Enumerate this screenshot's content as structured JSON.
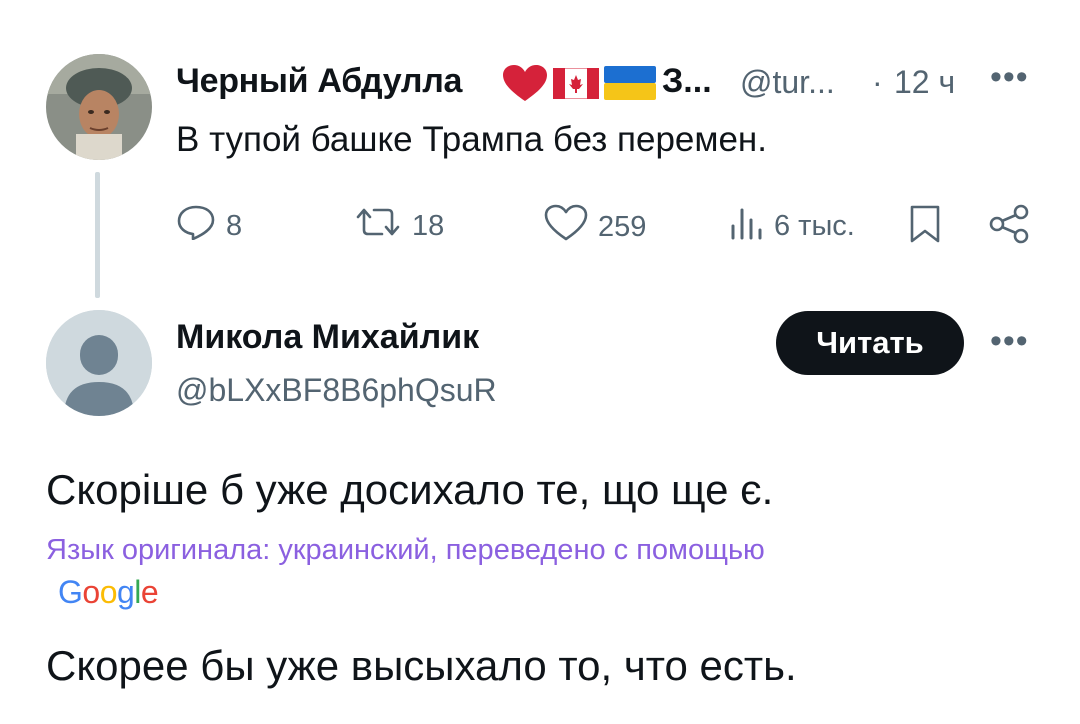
{
  "tweet": {
    "author_name": "Черный Абдулла",
    "author_name_tail": "З...",
    "handle": "@tur...",
    "separator": "·",
    "time": "12 ч",
    "more": "•••",
    "text": "В тупой башке Трампа без перемен.",
    "actions": {
      "replies": "8",
      "retweets": "18",
      "likes": "259",
      "views": "6 тыс."
    }
  },
  "reply": {
    "author_name": "Микола Михайлик",
    "handle": "@bLXxBF8B6phQsuR",
    "follow_label": "Читать",
    "more": "•••",
    "original_text": "Скоріше б уже досихало те, що ще є.",
    "translation_note": "Язык оригинала: украинский, переведено с помощью",
    "translation_provider": "Google",
    "translated_text": "Скорее бы уже высыхало то, что есть."
  },
  "colors": {
    "text": "#0f1419",
    "secondary": "#536471",
    "translation_note": "#8b60e0",
    "heart": "#d5223a",
    "button_bg": "#0f1419"
  },
  "icons": [
    "heart-emoji-icon",
    "canada-flag-icon",
    "ukraine-flag-icon",
    "reply-icon",
    "retweet-icon",
    "like-icon",
    "views-icon",
    "bookmark-icon",
    "share-icon"
  ]
}
